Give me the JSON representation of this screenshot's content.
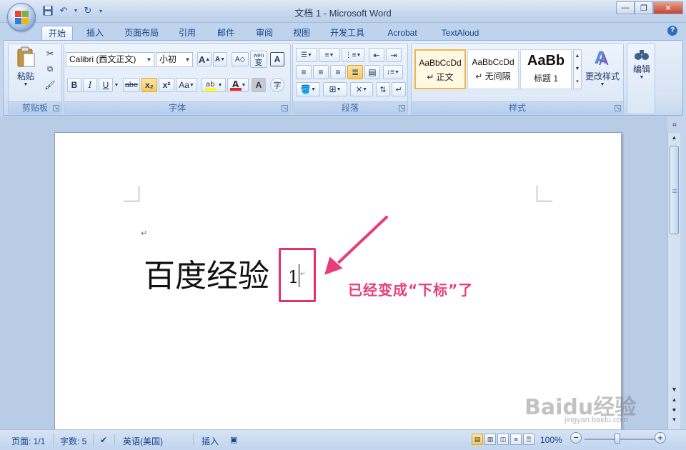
{
  "window": {
    "title": "文档 1 - Microsoft Word"
  },
  "qat": {
    "save_icon": "save-icon",
    "undo_icon": "undo-icon",
    "redo_icon": "redo-icon"
  },
  "tabs": [
    {
      "label": "开始",
      "active": true
    },
    {
      "label": "插入"
    },
    {
      "label": "页面布局"
    },
    {
      "label": "引用"
    },
    {
      "label": "邮件"
    },
    {
      "label": "审阅"
    },
    {
      "label": "视图"
    },
    {
      "label": "开发工具"
    },
    {
      "label": "Acrobat"
    },
    {
      "label": "TextAloud"
    }
  ],
  "ribbon": {
    "clipboard": {
      "label": "剪贴板",
      "paste_label": "粘贴"
    },
    "font": {
      "label": "字体",
      "font_name": "Calibri (西文正文)",
      "font_size": "小初",
      "wen": "wén",
      "wen_char": "变",
      "bold": "B",
      "italic": "I",
      "underline": "U",
      "strike": "abe",
      "subscript": "x₂",
      "superscript": "x²",
      "change_case": "Aa",
      "grow": "A",
      "shrink": "A",
      "char_shade": "A",
      "enclose": "字"
    },
    "paragraph": {
      "label": "段落"
    },
    "styles": {
      "label": "样式",
      "items": [
        {
          "sample": "AaBbCcDd",
          "name": "↵ 正文"
        },
        {
          "sample": "AaBbCcDd",
          "name": "↵ 无间隔"
        },
        {
          "sample": "AaBb",
          "name": "标题 1"
        }
      ],
      "change_label": "更改样式"
    },
    "editing": {
      "label": "编辑"
    }
  },
  "document": {
    "text": "百度经验",
    "subscript_text": "1",
    "annotation": "已经变成“下标”了"
  },
  "watermark": {
    "text": "Baidu经验",
    "sub": "jingyan.baidu.com"
  },
  "status": {
    "page": "页面: 1/1",
    "words": "字数: 5",
    "language": "英语(美国)",
    "mode": "插入",
    "zoom": "100%"
  },
  "colors": {
    "annotation": "#e83d79",
    "highlight_box": "#e8306a",
    "ribbon_bg": "#dbe7f6"
  }
}
